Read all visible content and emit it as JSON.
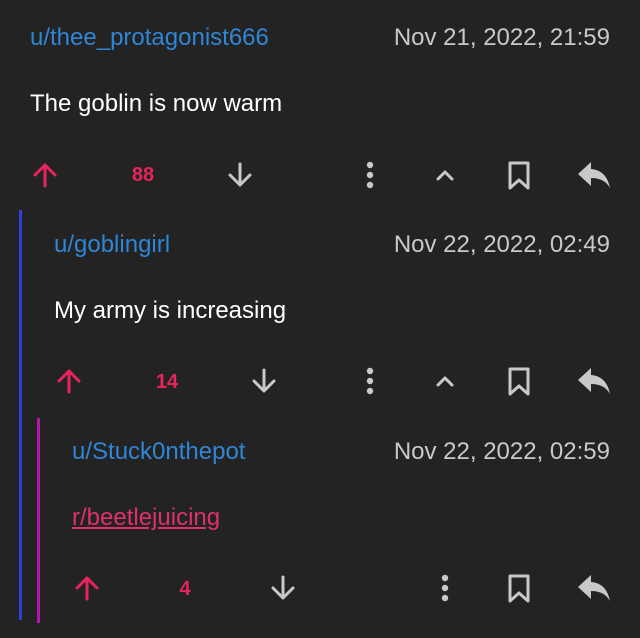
{
  "colors": {
    "background": "#232323",
    "username": "#2f86d6",
    "upvoted": "#e8245d",
    "icon": "#c9c9c9",
    "thread_level1": "#2f3fd8",
    "thread_level2": "#b316b0",
    "link": "#e0306a"
  },
  "comments": [
    {
      "author": "u/thee_protagonist666",
      "timestamp": "Nov 21, 2022, 21:59",
      "text": "The goblin is now warm",
      "score": "88",
      "upvoted": true
    },
    {
      "author": "u/goblingirl",
      "timestamp": "Nov 22, 2022, 02:49",
      "text": "My army is increasing",
      "score": "14",
      "upvoted": true
    },
    {
      "author": "u/Stuck0nthepot",
      "timestamp": "Nov 22, 2022, 02:59",
      "link_text": "r/beetlejuicing",
      "score": "4",
      "upvoted": true
    }
  ],
  "icons": {
    "upvote": "arrow-up-icon",
    "downvote": "arrow-down-icon",
    "more": "more-vertical-icon",
    "collapse": "chevron-up-icon",
    "save": "bookmark-icon",
    "reply": "reply-icon"
  }
}
